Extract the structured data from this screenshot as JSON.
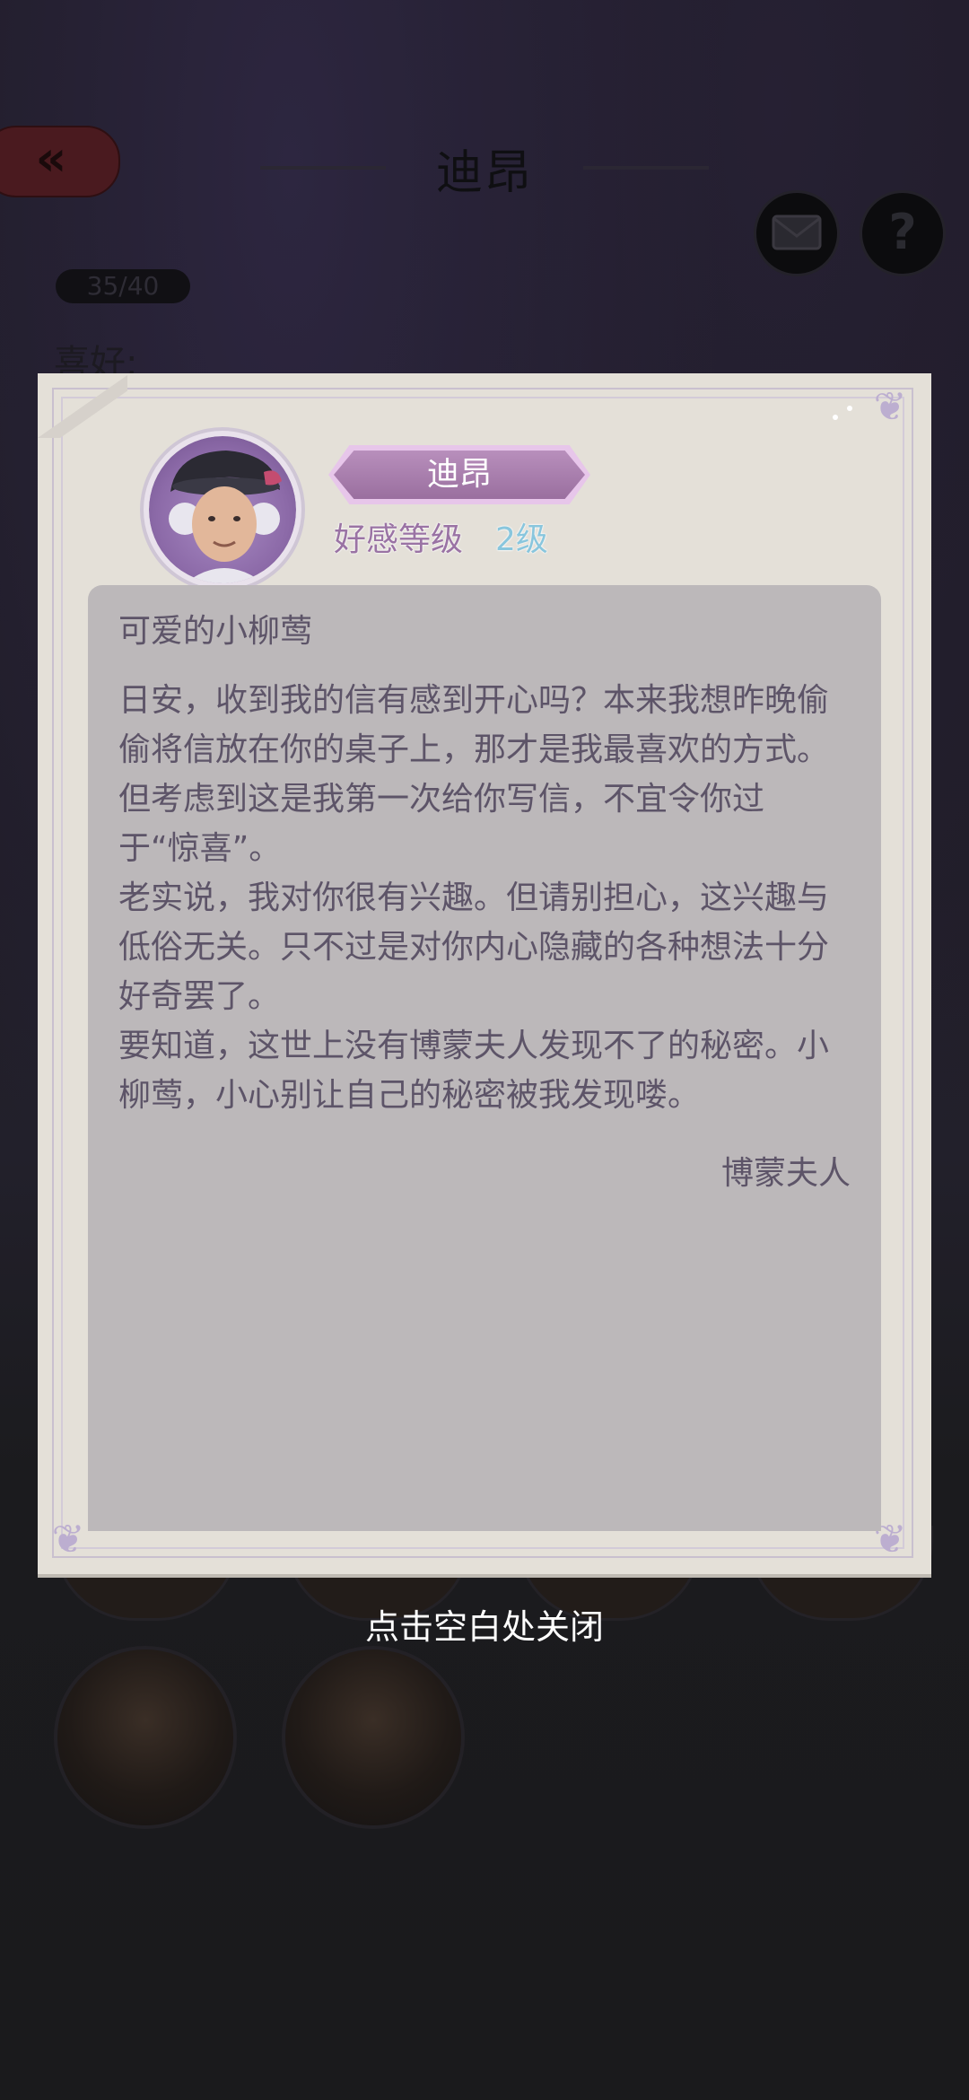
{
  "background": {
    "back_icon": "«",
    "title": "迪昂",
    "mail_icon": "envelope-icon",
    "help_icon": "?",
    "count": "35/40",
    "hobby_label": "喜好:"
  },
  "letter": {
    "character_name": "迪昂",
    "affinity_label": "好感等级",
    "affinity_level": "2级",
    "salutation": "可爱的小柳莺",
    "paragraphs": [
      "日安，收到我的信有感到开心吗？本来我想昨晚偷偷将信放在你的桌子上，那才是我最喜欢的方式。但考虑到这是我第一次给你写信，不宜令你过于“惊喜”。",
      "老实说，我对你很有兴趣。但请别担心，这兴趣与低俗无关。只不过是对你内心隐藏的各种想法十分好奇罢了。",
      "要知道，这世上没有博蒙夫人发现不了的秘密。小柳莺，小心别让自己的秘密被我发现喽。"
    ],
    "signature": "博蒙夫人"
  },
  "close_hint": "点击空白处关闭",
  "colors": {
    "badge": "#a57cab",
    "affinity_text": "#9a73a4",
    "level_text": "#89c6dd",
    "letter_text": "#5d5468",
    "paper": "#e4e0d8",
    "letter_bg": "#bcb8ba"
  }
}
